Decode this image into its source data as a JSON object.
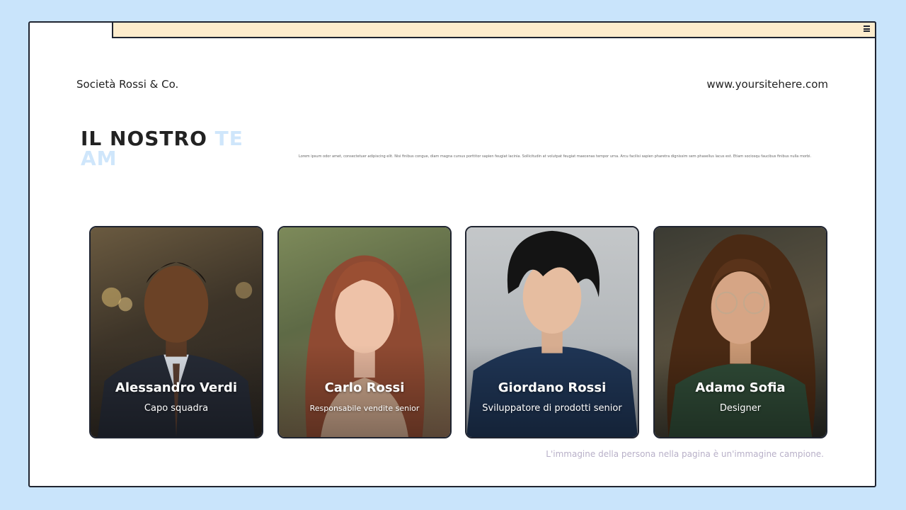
{
  "header": {
    "company": "Società Rossi & Co.",
    "website": "www.yoursitehere.com"
  },
  "section": {
    "title_main": "IL NOSTRO ",
    "title_accent": "TEAM",
    "description": "Lorem ipsum odor amet, consectetuer adipiscing elit. Nisi finibus congue, diam magna cursus porttitor sapien feugiat lacinia. Sollicitudin at volutpat feugiat maecenas tempor urna. Arcu facilisi sapien pharetra dignissim sem phasellus lacus est. Etiam sociosqu faucibus finibus nulla morbi."
  },
  "team": [
    {
      "name": "Alessandro Verdi",
      "role": "Capo squadra"
    },
    {
      "name": "Carlo Rossi",
      "role": "Responsabile vendite senior"
    },
    {
      "name": "Giordano Rossi",
      "role": "Sviluppatore di prodotti senior"
    },
    {
      "name": "Adamo Sofia",
      "role": "Designer"
    }
  ],
  "footer": {
    "note": "L'immagine della persona nella pagina è un'immagine campione."
  },
  "icons": {
    "menu": "menu-icon"
  },
  "colors": {
    "background": "#c9e4fb",
    "tabbar": "#fdeccc",
    "accent": "#cfe6fb",
    "border": "#1f2430"
  }
}
